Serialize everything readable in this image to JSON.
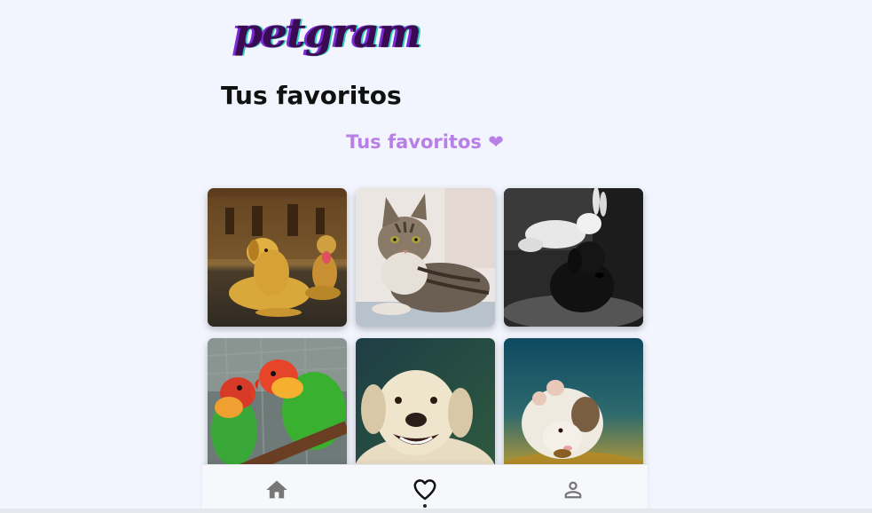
{
  "header": {
    "logo_text": "petgram"
  },
  "main": {
    "title": "Tus favoritos",
    "subtitle": "Tus favoritos ❤"
  },
  "favorites": [
    {
      "icon": "dog-photo"
    },
    {
      "icon": "cat-photo"
    },
    {
      "icon": "rabbit-dog-photo"
    },
    {
      "icon": "parrots-photo"
    },
    {
      "icon": "labrador-photo"
    },
    {
      "icon": "hamster-photo"
    }
  ],
  "navbar": {
    "items": [
      {
        "icon": "home-icon"
      },
      {
        "icon": "heart-icon",
        "active": true
      },
      {
        "icon": "user-icon"
      }
    ]
  },
  "colors": {
    "background": "#f2f5fd",
    "accent": "#b87fe6",
    "logo": "#3a0a52"
  }
}
